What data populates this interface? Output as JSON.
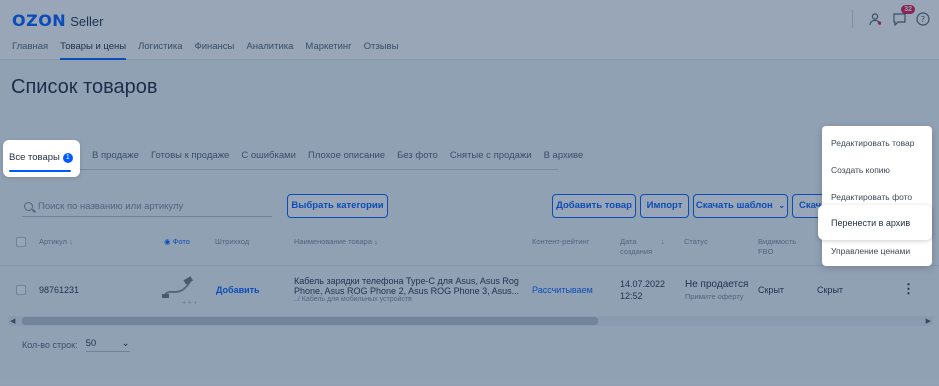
{
  "header": {
    "logo": "OZON",
    "logo_suffix": "Seller",
    "notifications_count": "32",
    "icons": [
      "user-icon",
      "chat-icon",
      "help-icon"
    ]
  },
  "nav": [
    {
      "label": "Главная"
    },
    {
      "label": "Товары и цены",
      "active": true
    },
    {
      "label": "Логистика"
    },
    {
      "label": "Финансы"
    },
    {
      "label": "Аналитика"
    },
    {
      "label": "Маркетинг"
    },
    {
      "label": "Отзывы"
    }
  ],
  "page_title": "Список товаров",
  "tabs": {
    "active_label": "Все товары",
    "active_count": "1",
    "items": [
      "В продаже",
      "Готовы к продаже",
      "С ошибками",
      "Плохое описание",
      "Без фото",
      "Снятые с продажи",
      "В архиве"
    ]
  },
  "toolbar": {
    "search_placeholder": "Поиск по названию или артикулу",
    "choose_categories": "Выбрать категории",
    "add_product": "Добавить товар",
    "import": "Импорт",
    "download_template": "Скачать шаблон",
    "download_partial": "Скач"
  },
  "table": {
    "headers": {
      "sku": "Артикул",
      "photo": "Фото",
      "barcode": "Штрихкод",
      "name": "Наименование товара",
      "content_rating": "Контент-рейтинг",
      "created": "Дата создания",
      "status": "Статус",
      "visibility": "Видимость FBO"
    },
    "row": {
      "sku": "98761231",
      "barcode_action": "Добавить",
      "name": "Кабель зарядки телефона Type-C для Asus, Asus Rog Phone, Asus ROG Phone 2, Asus ROG Phone 3, Asus...",
      "category": "../ Кабель для мобильных устройств",
      "content_rating": "Рассчитываем",
      "created_date": "14.07.2022",
      "created_time": "12:52",
      "status": "Не продается",
      "status_hint": "Примите оферту",
      "visibility_fbo": "Скрыт",
      "visibility_fbs": "Скрыт"
    }
  },
  "pagination": {
    "rows_label": "Кол-во строк:",
    "rows_value": "50"
  },
  "menu": {
    "items": [
      "Редактировать товар",
      "Создать копию",
      "Редактировать фото",
      "Перенести в архив",
      "Управление ценами"
    ],
    "highlighted": "Перенести в архив"
  },
  "colors": {
    "accent": "#005bff",
    "overlay": "#1b3a60",
    "badge": "#e8134c"
  }
}
